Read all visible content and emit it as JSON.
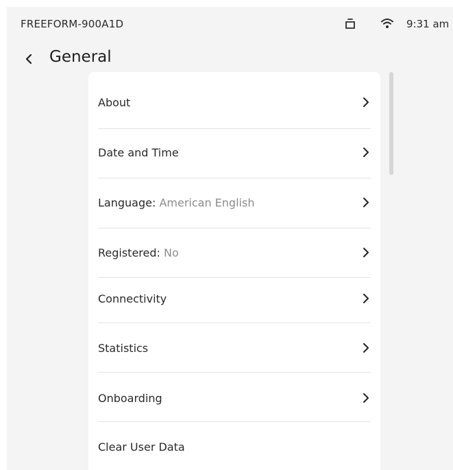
{
  "status_bar": {
    "device_name": "FREEFORM-900A1D",
    "time": "9:31 am",
    "battery_icon": "battery-icon",
    "wifi_icon": "wifi-icon"
  },
  "header": {
    "title": "General",
    "back_icon": "chevron-left-icon"
  },
  "menu": {
    "items": [
      {
        "label": "About",
        "value": "",
        "chevron": true
      },
      {
        "label": "Date and Time",
        "value": "",
        "chevron": true
      },
      {
        "label": "Language:",
        "value": "American English",
        "chevron": true
      },
      {
        "label": "Registered:",
        "value": "No",
        "chevron": true
      },
      {
        "label": "Connectivity",
        "value": "",
        "chevron": true
      },
      {
        "label": "Statistics",
        "value": "",
        "chevron": true
      },
      {
        "label": "Onboarding",
        "value": "",
        "chevron": true
      },
      {
        "label": "Clear User Data",
        "value": "",
        "chevron": false
      }
    ]
  },
  "colors": {
    "background": "#f4f4f4",
    "card": "#ffffff",
    "divider": "#e3e3e3",
    "secondary_text": "#8c8c8c"
  }
}
